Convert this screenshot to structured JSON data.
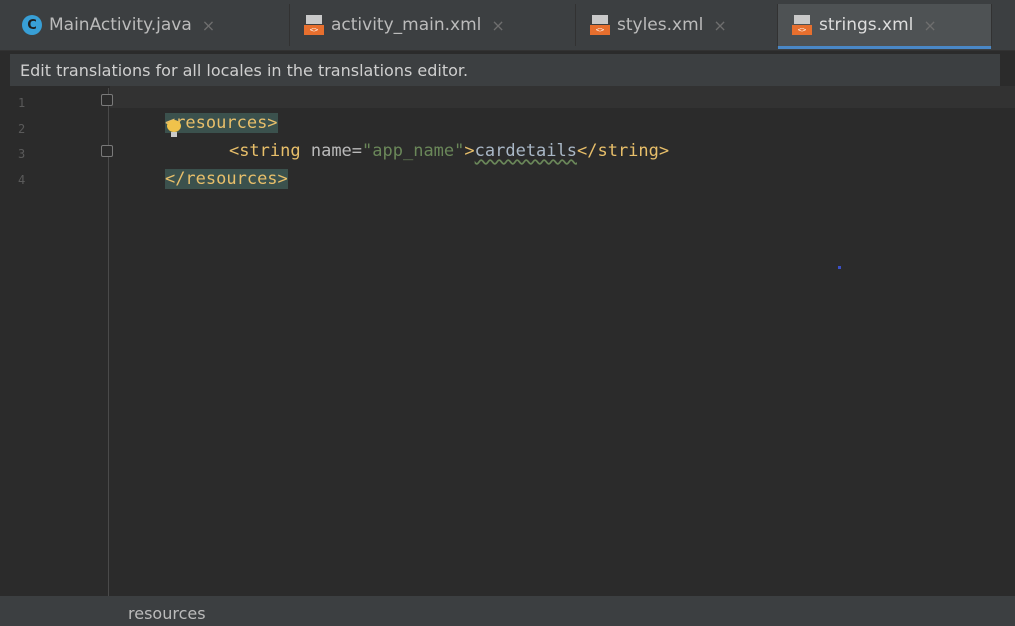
{
  "tabs": [
    {
      "label": "MainActivity.java",
      "icon": "java-class-icon",
      "active": false
    },
    {
      "label": "activity_main.xml",
      "icon": "xml-file-icon",
      "active": false
    },
    {
      "label": "styles.xml",
      "icon": "xml-file-icon",
      "active": false
    },
    {
      "label": "strings.xml",
      "icon": "xml-file-icon",
      "active": true
    }
  ],
  "tab_close_glyph": "×",
  "java_icon_letter": "C",
  "xml_icon_text": "<>",
  "banner": {
    "text": "Edit translations for all locales in the translations editor."
  },
  "editor": {
    "line_numbers": [
      "1",
      "2",
      "3",
      "4"
    ],
    "line1_tag": "<resources>",
    "line2_open": "<string ",
    "line2_attr": "name=",
    "line2_value": "\"app_name\"",
    "line2_gt": ">",
    "line2_text": "cardetails",
    "line2_close": "</string>",
    "line3_tag": "</resources>"
  },
  "breadcrumb": {
    "text": "resources"
  },
  "colors": {
    "accent": "#4a88c7",
    "tag": "#e8bf6a",
    "value": "#6a8759"
  }
}
